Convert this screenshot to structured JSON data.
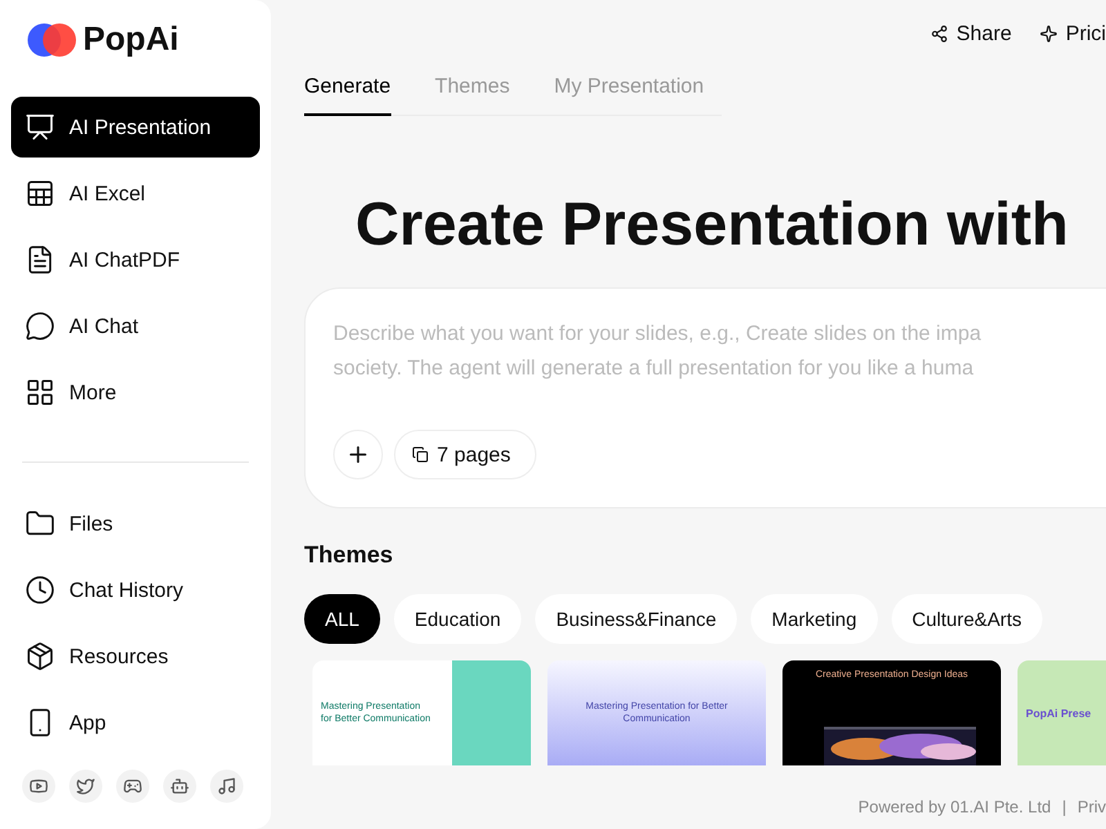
{
  "brand": "PopAi",
  "nav": [
    {
      "label": "AI Presentation",
      "selected": true
    },
    {
      "label": "AI Excel",
      "selected": false
    },
    {
      "label": "AI ChatPDF",
      "selected": false
    },
    {
      "label": "AI Chat",
      "selected": false
    },
    {
      "label": "More",
      "selected": false
    }
  ],
  "nav_secondary": [
    {
      "label": "Files"
    },
    {
      "label": "Chat History"
    },
    {
      "label": "Resources"
    },
    {
      "label": "App"
    }
  ],
  "top_actions": [
    {
      "label": "Share"
    },
    {
      "label": "Prici"
    }
  ],
  "tabs": [
    {
      "label": "Generate",
      "selected": true
    },
    {
      "label": "Themes",
      "selected": false
    },
    {
      "label": "My Presentation",
      "selected": false
    }
  ],
  "title": "Create Presentation with",
  "prompt": {
    "placeholder": "Describe what you want for your slides, e.g., Create slides on the impa\nsociety. The agent will generate a full presentation for you like a huma",
    "pages": "7 pages"
  },
  "themes_heading": "Themes",
  "theme_filters": [
    {
      "label": "ALL",
      "selected": true
    },
    {
      "label": "Education",
      "selected": false
    },
    {
      "label": "Business&Finance",
      "selected": false
    },
    {
      "label": "Marketing",
      "selected": false
    },
    {
      "label": "Culture&Arts",
      "selected": false
    }
  ],
  "theme_cards": [
    {
      "kind": "mint",
      "title": "Mastering Presentation for Better Communication"
    },
    {
      "kind": "lavender",
      "title": "Mastering Presentation for Better Communication"
    },
    {
      "kind": "dark",
      "title": "Creative Presentation Design Ideas"
    },
    {
      "kind": "green",
      "title": "PopAi Prese"
    }
  ],
  "footer": {
    "credit": "Powered by 01.AI Pte. Ltd",
    "separator": "|",
    "link": "Priv"
  }
}
